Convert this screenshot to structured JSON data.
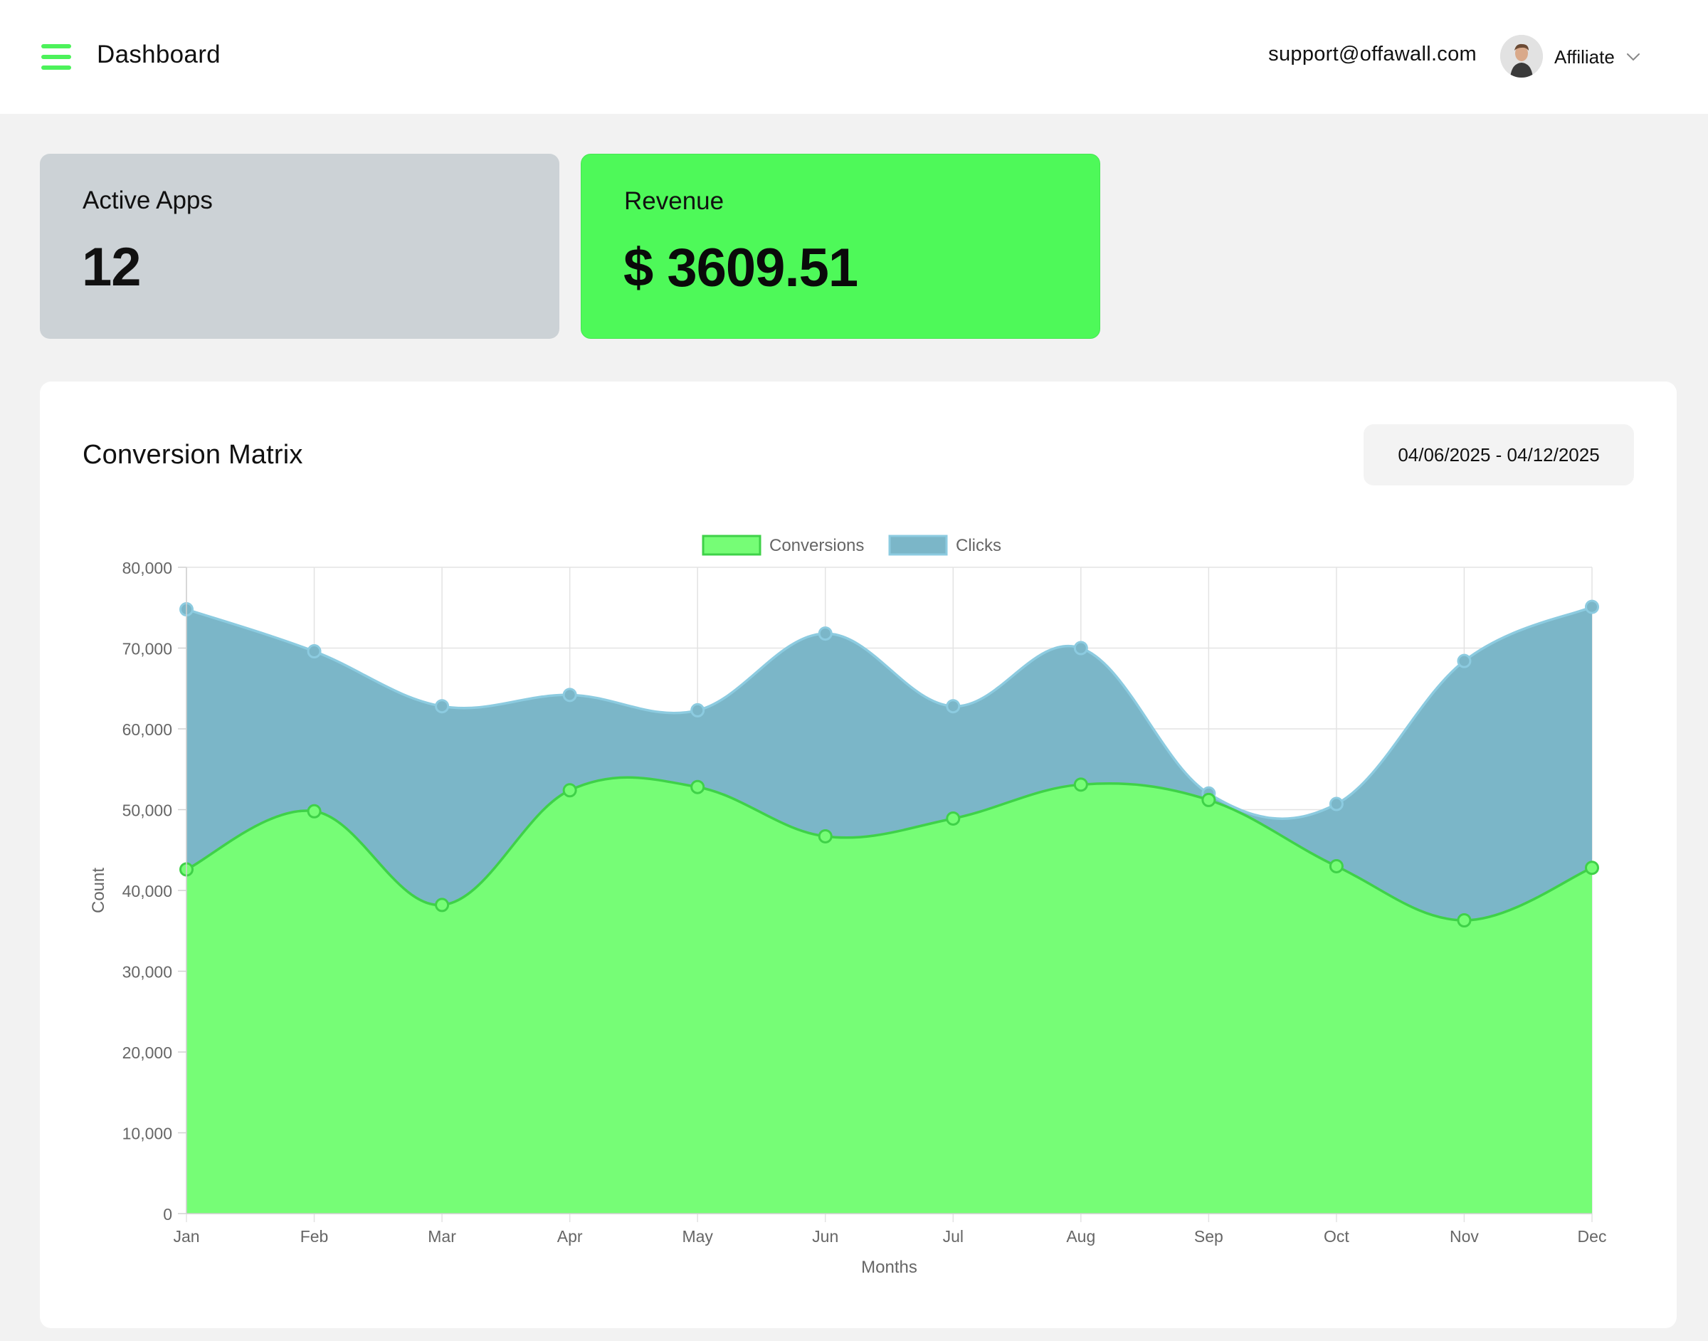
{
  "header": {
    "title": "Dashboard",
    "email": "support@offawall.com",
    "role": "Affiliate",
    "menu_icon": "hamburger-menu-icon",
    "accent": "#4cf25a"
  },
  "stats": {
    "active_apps": {
      "label": "Active Apps",
      "value": "12"
    },
    "revenue": {
      "label": "Revenue",
      "value": "$ 3609.51"
    }
  },
  "panel": {
    "title": "Conversion Matrix",
    "date_range": "04/06/2025 - 04/12/2025"
  },
  "chart_data": {
    "type": "area",
    "categories": [
      "Jan",
      "Feb",
      "Mar",
      "Apr",
      "May",
      "Jun",
      "Jul",
      "Aug",
      "Sep",
      "Oct",
      "Nov",
      "Dec"
    ],
    "series": [
      {
        "name": "Conversions",
        "values": [
          42600,
          49800,
          38200,
          52400,
          52800,
          46700,
          48900,
          53100,
          51200,
          43000,
          36300,
          42800
        ],
        "color": "#4ef959",
        "fill": "#76fd76",
        "line": "#3fd148"
      },
      {
        "name": "Clicks",
        "values": [
          74800,
          69600,
          62800,
          64200,
          62300,
          71800,
          62800,
          70000,
          52000,
          50700,
          68400,
          75100
        ],
        "color": "#7ab6c8",
        "fill": "#7bb6c8",
        "line": "#8ccbe0"
      }
    ],
    "xlabel": "Months",
    "ylabel": "Count",
    "ylim": [
      0,
      80000
    ],
    "yticks": [
      "0",
      "10,000",
      "20,000",
      "30,000",
      "40,000",
      "50,000",
      "60,000",
      "70,000",
      "80,000"
    ],
    "grid": true,
    "legend": "top-center"
  }
}
